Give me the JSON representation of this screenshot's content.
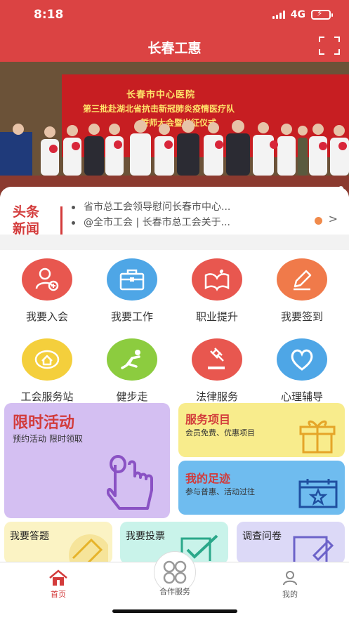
{
  "status": {
    "time": "8:18",
    "network": "4G"
  },
  "nav": {
    "title": "长春工惠"
  },
  "banner": {
    "line1": "长春市中心医院",
    "line2": "第三批赴湖北省抗击新冠肺炎疫情医疗队",
    "line3": "誓师大会暨出征仪式"
  },
  "news": {
    "badge_line1": "头条",
    "badge_line2": "新闻",
    "items": [
      "省市总工会领导慰问长春市中心...",
      "@全市工会 | 长春市总工会关于..."
    ],
    "more": ">"
  },
  "grid": [
    {
      "label": "我要入会",
      "icon": "add-member-icon",
      "color": "#e8574f"
    },
    {
      "label": "我要工作",
      "icon": "briefcase-icon",
      "color": "#4ea6e6"
    },
    {
      "label": "职业提升",
      "icon": "book-heart-icon",
      "color": "#e8574f"
    },
    {
      "label": "我要签到",
      "icon": "pencil-icon",
      "color": "#f07a4a"
    },
    {
      "label": "工会服务站",
      "icon": "house-icon",
      "color": "#f4cf3c"
    },
    {
      "label": "健步走",
      "icon": "runner-icon",
      "color": "#8ccc3f"
    },
    {
      "label": "法律服务",
      "icon": "gavel-icon",
      "color": "#e8574f"
    },
    {
      "label": "心理辅导",
      "icon": "heart-icon",
      "color": "#4ea6e6"
    }
  ],
  "cards": {
    "limited": {
      "title": "限时活动",
      "sub": "预约活动 限时领取"
    },
    "service": {
      "title": "服务项目",
      "sub": "会员免费、优惠项目"
    },
    "footprint": {
      "title": "我的足迹",
      "sub": "参与普惠、活动过往"
    },
    "quiz": {
      "title": "我要答题"
    },
    "vote": {
      "title": "我要投票"
    },
    "survey": {
      "title": "调查问卷"
    }
  },
  "tabs": {
    "home": "首页",
    "coop": "合作服务",
    "mine": "我的"
  }
}
